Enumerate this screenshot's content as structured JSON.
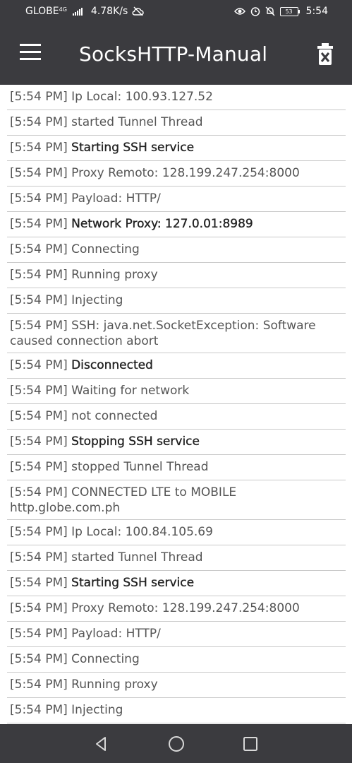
{
  "status_bar": {
    "carrier": "GLOBE",
    "network_type": "4G",
    "speed": "4.78K/s",
    "battery": "53",
    "time": "5:54"
  },
  "app_bar": {
    "title": "SocksHTTP-Manual",
    "menu_icon": "hamburger-menu-icon",
    "clear_icon": "clear-log-icon"
  },
  "log": [
    {
      "time": "[5:54 PM]",
      "msg": "Ip Local: 100.93.127.52",
      "bold": false
    },
    {
      "time": "[5:54 PM]",
      "msg": "started Tunnel Thread",
      "bold": false
    },
    {
      "time": "[5:54 PM]",
      "msg": "Starting SSH service",
      "bold": true
    },
    {
      "time": "[5:54 PM]",
      "msg": "Proxy Remoto: 128.199.247.254:8000",
      "bold": false
    },
    {
      "time": "[5:54 PM]",
      "msg": "Payload: HTTP/",
      "bold": false
    },
    {
      "time": "[5:54 PM]",
      "msg": "Network Proxy: 127.0.01:8989",
      "bold": true
    },
    {
      "time": "[5:54 PM]",
      "msg": "Connecting",
      "bold": false
    },
    {
      "time": "[5:54 PM]",
      "msg": "Running proxy",
      "bold": false
    },
    {
      "time": "[5:54 PM]",
      "msg": "Injecting",
      "bold": false
    },
    {
      "time": "[5:54 PM]",
      "msg": "SSH: java.net.SocketException: Software caused connection abort",
      "bold": false
    },
    {
      "time": "[5:54 PM]",
      "msg": "Disconnected",
      "bold": true
    },
    {
      "time": "[5:54 PM]",
      "msg": "Waiting for network",
      "bold": false
    },
    {
      "time": "[5:54 PM]",
      "msg": "not connected",
      "bold": false
    },
    {
      "time": "[5:54 PM]",
      "msg": "Stopping SSH service",
      "bold": true
    },
    {
      "time": "[5:54 PM]",
      "msg": "stopped Tunnel Thread",
      "bold": false
    },
    {
      "time": "[5:54 PM]",
      "msg": "CONNECTED LTE to MOBILE http.globe.com.ph",
      "bold": false
    },
    {
      "time": "[5:54 PM]",
      "msg": "Ip Local: 100.84.105.69",
      "bold": false
    },
    {
      "time": "[5:54 PM]",
      "msg": "started Tunnel Thread",
      "bold": false
    },
    {
      "time": "[5:54 PM]",
      "msg": "Starting SSH service",
      "bold": true
    },
    {
      "time": "[5:54 PM]",
      "msg": "Proxy Remoto: 128.199.247.254:8000",
      "bold": false
    },
    {
      "time": "[5:54 PM]",
      "msg": "Payload: HTTP/",
      "bold": false
    },
    {
      "time": "[5:54 PM]",
      "msg": "Connecting",
      "bold": false
    },
    {
      "time": "[5:54 PM]",
      "msg": "Running proxy",
      "bold": false
    },
    {
      "time": "[5:54 PM]",
      "msg": "Injecting",
      "bold": false
    }
  ],
  "nav_bar": {
    "back_icon": "back-triangle-icon",
    "home_icon": "home-circle-icon",
    "recents_icon": "recents-square-icon"
  }
}
